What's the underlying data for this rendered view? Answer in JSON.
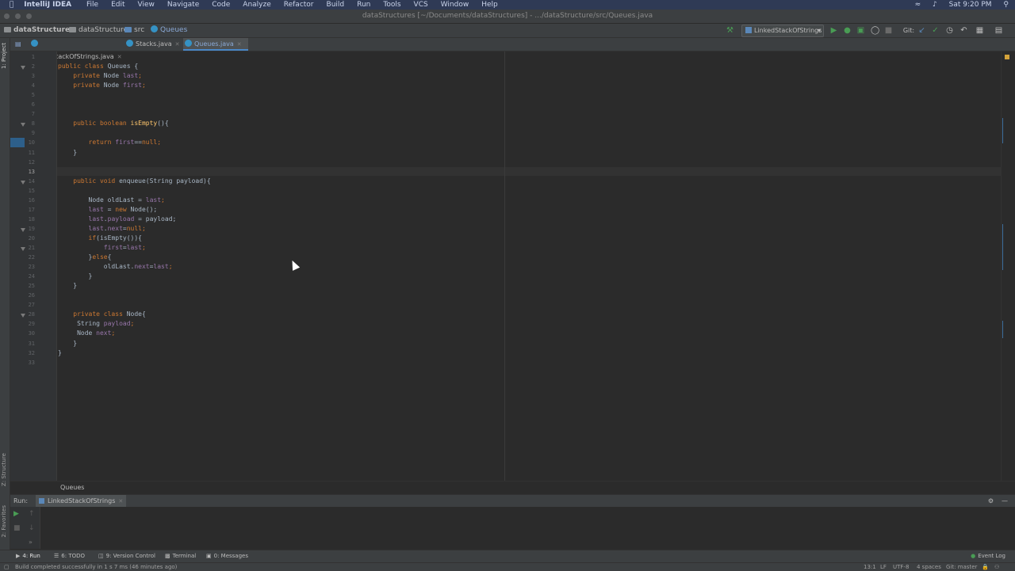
{
  "menubar": {
    "app_name": "IntelliJ IDEA",
    "items": [
      "File",
      "Edit",
      "View",
      "Navigate",
      "Code",
      "Analyze",
      "Refactor",
      "Build",
      "Run",
      "Tools",
      "VCS",
      "Window",
      "Help"
    ],
    "clock": "Sat 9:20 PM"
  },
  "window": {
    "title": "dataStructures [~/Documents/dataStructures] - .../dataStructure/src/Queues.java"
  },
  "navbar": {
    "crumbs": [
      "dataStructures",
      "dataStructure",
      "src",
      "Queues"
    ],
    "run_config": "LinkedStackOfStrings",
    "git_label": "Git:"
  },
  "tabs": [
    {
      "label": "LinkedStackOfStrings.java"
    },
    {
      "label": "Stacks.java"
    },
    {
      "label": "Queues.java",
      "active": true
    }
  ],
  "editor": {
    "line_numbers": [
      "1",
      "2",
      "3",
      "4",
      "5",
      "6",
      "7",
      "8",
      "9",
      "10",
      "11",
      "12",
      "13",
      "14",
      "15",
      "16",
      "17",
      "18",
      "19",
      "20",
      "21",
      "22",
      "23",
      "24",
      "25",
      "26",
      "27",
      "28",
      "29",
      "30",
      "31",
      "32",
      "33"
    ],
    "current_line": "13",
    "breadcrumb": "Queues"
  },
  "code": [
    {
      "parts": []
    },
    {
      "parts": [
        {
          "t": "public class ",
          "c": "kw"
        },
        {
          "t": "Queues",
          "c": "pl"
        },
        {
          "t": " {",
          "c": "pl"
        }
      ]
    },
    {
      "parts": [
        {
          "t": "    private ",
          "c": "kw"
        },
        {
          "t": "Node ",
          "c": "pl"
        },
        {
          "t": "last",
          "c": "fld"
        },
        {
          "t": ";",
          "c": "kw"
        }
      ]
    },
    {
      "parts": [
        {
          "t": "    private ",
          "c": "kw"
        },
        {
          "t": "Node ",
          "c": "pl"
        },
        {
          "t": "first",
          "c": "fld"
        },
        {
          "t": ";",
          "c": "kw"
        }
      ]
    },
    {
      "parts": []
    },
    {
      "parts": []
    },
    {
      "parts": []
    },
    {
      "parts": [
        {
          "t": "    public boolean ",
          "c": "kw"
        },
        {
          "t": "isEmpty",
          "c": "fn"
        },
        {
          "t": "(){",
          "c": "pl"
        }
      ]
    },
    {
      "parts": []
    },
    {
      "parts": [
        {
          "t": "        return ",
          "c": "kw"
        },
        {
          "t": "first",
          "c": "fld"
        },
        {
          "t": "==",
          "c": "pl"
        },
        {
          "t": "null",
          "c": "kw"
        },
        {
          "t": ";",
          "c": "kw"
        }
      ]
    },
    {
      "parts": [
        {
          "t": "    }",
          "c": "pl"
        }
      ]
    },
    {
      "parts": []
    },
    {
      "parts": []
    },
    {
      "parts": [
        {
          "t": "    public void ",
          "c": "kw"
        },
        {
          "t": "enqueue",
          "c": "pl"
        },
        {
          "t": "(String payload){",
          "c": "pl"
        }
      ]
    },
    {
      "parts": []
    },
    {
      "parts": [
        {
          "t": "        Node oldLast = ",
          "c": "pl"
        },
        {
          "t": "last",
          "c": "fld"
        },
        {
          "t": ";",
          "c": "kw"
        }
      ]
    },
    {
      "parts": [
        {
          "t": "        ",
          "c": "pl"
        },
        {
          "t": "last",
          "c": "fld"
        },
        {
          "t": " = ",
          "c": "pl"
        },
        {
          "t": "new ",
          "c": "kw"
        },
        {
          "t": "Node();",
          "c": "pl"
        }
      ]
    },
    {
      "parts": [
        {
          "t": "        ",
          "c": "pl"
        },
        {
          "t": "last",
          "c": "fld"
        },
        {
          "t": ".",
          "c": "pl"
        },
        {
          "t": "payload",
          "c": "fld"
        },
        {
          "t": " = payload;",
          "c": "pl"
        }
      ]
    },
    {
      "parts": [
        {
          "t": "        ",
          "c": "pl"
        },
        {
          "t": "last",
          "c": "fld"
        },
        {
          "t": ".",
          "c": "pl"
        },
        {
          "t": "next",
          "c": "fld"
        },
        {
          "t": "=",
          "c": "pl"
        },
        {
          "t": "null",
          "c": "kw"
        },
        {
          "t": ";",
          "c": "kw"
        }
      ]
    },
    {
      "parts": [
        {
          "t": "        ",
          "c": "pl"
        },
        {
          "t": "if",
          "c": "kw"
        },
        {
          "t": "(isEmpty()){",
          "c": "pl"
        }
      ]
    },
    {
      "parts": [
        {
          "t": "            ",
          "c": "pl"
        },
        {
          "t": "first",
          "c": "fld"
        },
        {
          "t": "=",
          "c": "pl"
        },
        {
          "t": "last",
          "c": "fld"
        },
        {
          "t": ";",
          "c": "kw"
        }
      ]
    },
    {
      "parts": [
        {
          "t": "        }",
          "c": "pl"
        },
        {
          "t": "else",
          "c": "kw"
        },
        {
          "t": "{",
          "c": "pl"
        }
      ]
    },
    {
      "parts": [
        {
          "t": "            oldLast.",
          "c": "pl"
        },
        {
          "t": "next",
          "c": "fld"
        },
        {
          "t": "=",
          "c": "pl"
        },
        {
          "t": "last",
          "c": "fld"
        },
        {
          "t": ";",
          "c": "kw"
        }
      ]
    },
    {
      "parts": [
        {
          "t": "        }",
          "c": "pl"
        }
      ]
    },
    {
      "parts": [
        {
          "t": "    }",
          "c": "pl"
        }
      ]
    },
    {
      "parts": []
    },
    {
      "parts": []
    },
    {
      "parts": [
        {
          "t": "    private class ",
          "c": "kw"
        },
        {
          "t": "Node",
          "c": "pl"
        },
        {
          "t": "{",
          "c": "pl"
        }
      ]
    },
    {
      "parts": [
        {
          "t": "     String ",
          "c": "pl"
        },
        {
          "t": "payload",
          "c": "fld"
        },
        {
          "t": ";",
          "c": "kw"
        }
      ]
    },
    {
      "parts": [
        {
          "t": "     Node ",
          "c": "pl"
        },
        {
          "t": "next",
          "c": "fld"
        },
        {
          "t": ";",
          "c": "kw"
        }
      ]
    },
    {
      "parts": [
        {
          "t": "    }",
          "c": "pl"
        }
      ]
    },
    {
      "parts": [
        {
          "t": "}",
          "c": "pl"
        }
      ]
    },
    {
      "parts": []
    }
  ],
  "left_strip": {
    "project": "1: Project",
    "structure": "Z: Structure",
    "favorites": "2: Favorites"
  },
  "run_panel": {
    "label": "Run:",
    "tab": "LinkedStackOfStrings"
  },
  "tool_windows": [
    "4: Run",
    "6: TODO",
    "9: Version Control",
    "Terminal",
    "0: Messages"
  ],
  "event_log": "Event Log",
  "status": {
    "message": "Build completed successfully in 1 s 7 ms (46 minutes ago)",
    "position": "13:1",
    "line_sep": "LF",
    "encoding": "UTF-8",
    "indent": "4 spaces",
    "git": "Git: master"
  },
  "colors": {
    "accent": "#4a88c7",
    "keyword": "#cc7832",
    "field": "#9876aa",
    "method": "#ffc66d",
    "run_green": "#499c54"
  }
}
